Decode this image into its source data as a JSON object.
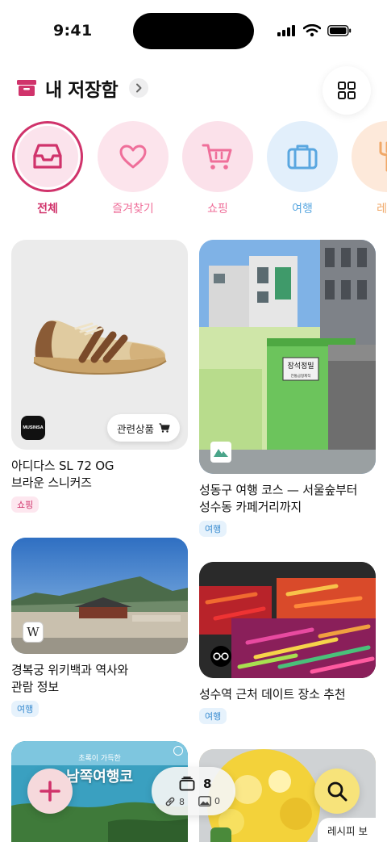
{
  "status_bar": {
    "time": "9:41"
  },
  "header": {
    "title": "내 저장함"
  },
  "categories": [
    {
      "label": "전체",
      "icon": "inbox-tray-icon",
      "color": "#d0336b",
      "bg": "#fbe3ec",
      "selected": true
    },
    {
      "label": "즐겨찾기",
      "icon": "heart-icon",
      "color": "#ef6f9a",
      "bg": "#fce4ec",
      "selected": false
    },
    {
      "label": "쇼핑",
      "icon": "shopping-cart-icon",
      "color": "#ef6f9a",
      "bg": "#fbe1ea",
      "selected": false
    },
    {
      "label": "여행",
      "icon": "suitcase-icon",
      "color": "#5aa7e0",
      "bg": "#e2effb",
      "selected": false
    },
    {
      "label": "레시",
      "icon": "fork-icon",
      "color": "#f0a868",
      "bg": "#fde9da",
      "selected": false
    }
  ],
  "cards": [
    {
      "title_line1": "아디다스 SL 72 OG",
      "title_line2": "브라운 스니커즈",
      "tag": "쇼핑",
      "source_logo": "MUSINSA",
      "action_label": "관련상품"
    },
    {
      "title_line1": "성동구 여행 코스 — 서울숲부터",
      "title_line2": "성수동 카페거리까지",
      "tag": "여행",
      "sign_text": "장석정밀",
      "sign_sub": "전통금형제작"
    },
    {
      "title_line1": "경복궁 위키백과 역사와",
      "title_line2": "관람 정보",
      "tag": "여행",
      "source_logo": "W"
    },
    {
      "title_line1": "성수역 근처 데이트 장소 추천",
      "tag": "여행"
    },
    {
      "overlay_small": "초록이 가득한",
      "overlay_big": "남쪽여행코"
    },
    {
      "action_label": "레시피 보"
    }
  ],
  "bottom_bar": {
    "total_count": "8",
    "link_count": "8",
    "image_count": "0"
  },
  "colors": {
    "accent": "#d0336b",
    "search_button": "#f7e37a",
    "add_button": "#f6d9dc"
  }
}
